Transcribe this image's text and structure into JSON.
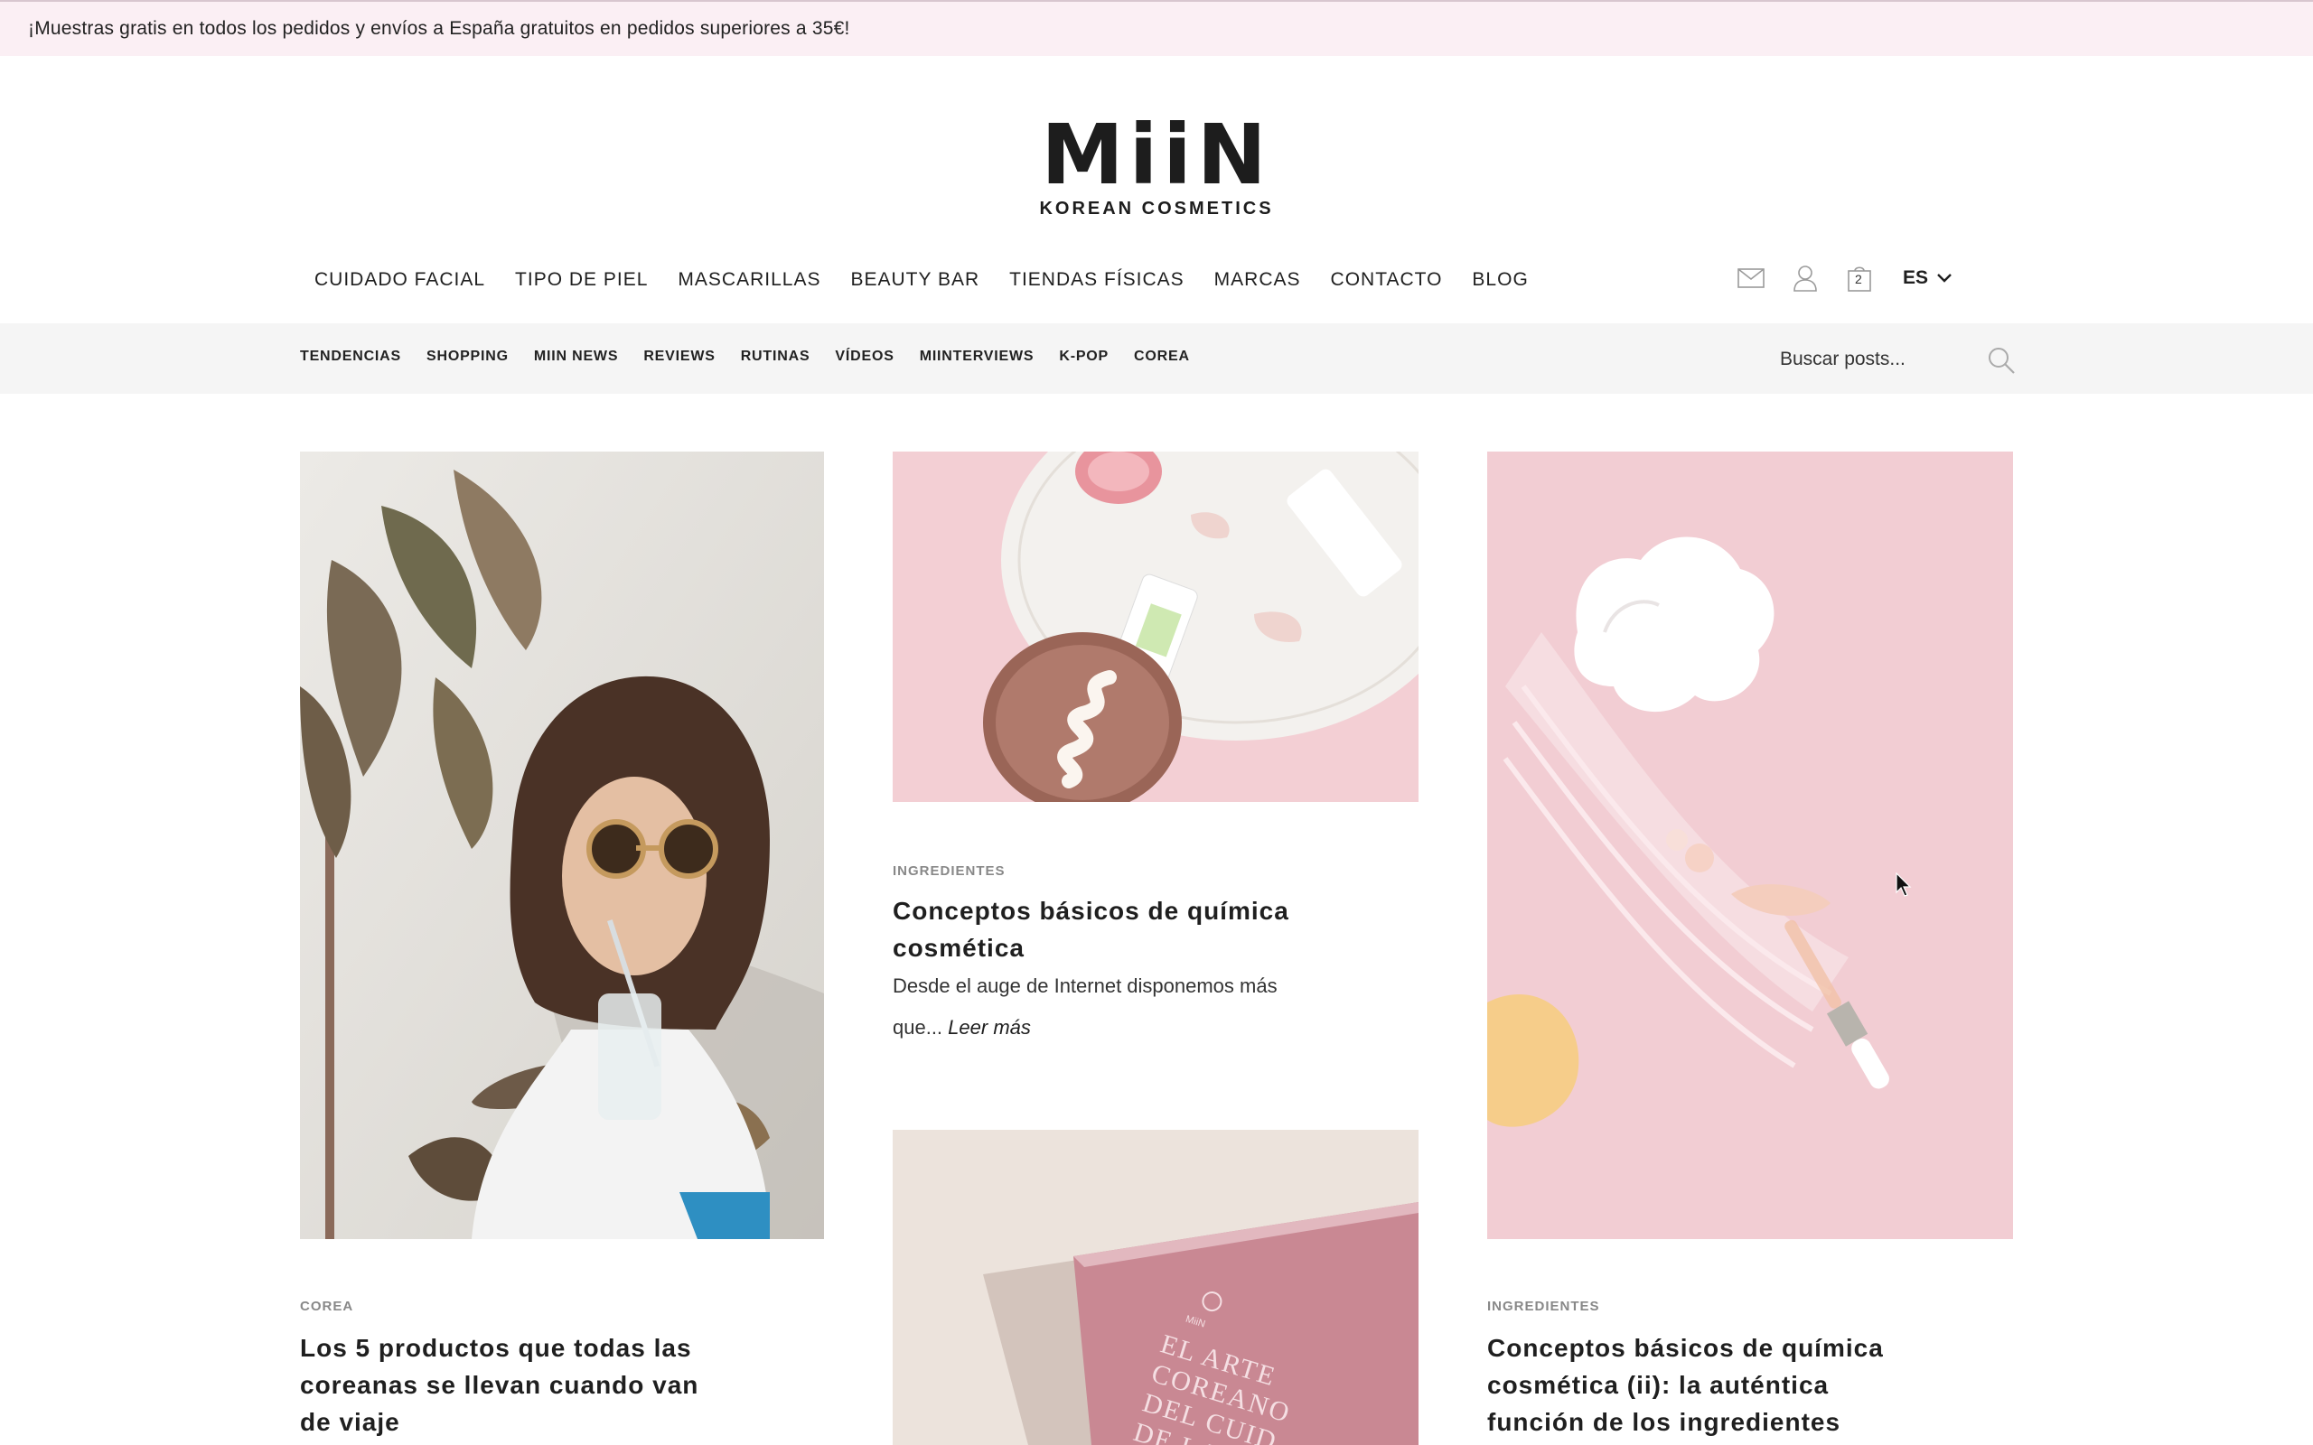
{
  "promo": {
    "text": "¡Muestras gratis en todos los pedidos y envíos a España gratuitos en pedidos superiores a 35€!"
  },
  "logo": {
    "mark": "MiiN",
    "sub": "KOREAN COSMETICS"
  },
  "main_nav": [
    "CUIDADO FACIAL",
    "TIPO DE PIEL",
    "MASCARILLAS",
    "BEAUTY BAR",
    "TIENDAS FÍSICAS",
    "MARCAS",
    "CONTACTO",
    "BLOG"
  ],
  "utilities": {
    "icons": [
      "mail-icon",
      "user-icon",
      "bag-icon"
    ],
    "cart_count": "2",
    "language": "ES"
  },
  "sub_nav": [
    "TENDENCIAS",
    "SHOPPING",
    "MIIN NEWS",
    "REVIEWS",
    "RUTINAS",
    "VÍDEOS",
    "MIINTERVIEWS",
    "K-POP",
    "COREA"
  ],
  "search": {
    "placeholder": "Buscar posts..."
  },
  "posts": [
    {
      "category": "COREA",
      "title": "Los 5 productos que todas las coreanas se llevan cuando van de viaje",
      "title_lines": [
        "Los 5 productos que todas las",
        "coreanas se llevan cuando van",
        "de viaje"
      ]
    },
    {
      "category": "INGREDIENTES",
      "title_lines": [
        "Conceptos básicos de química",
        "cosmética"
      ],
      "excerpt_lines": [
        "Desde el auge de Internet disponemos más",
        "que..."
      ],
      "read_more": "Leer más"
    },
    {
      "category": "INGREDIENTES",
      "title_lines": [
        "Conceptos básicos de química",
        "cosmética (ii): la auténtica",
        "función de los ingredientes"
      ]
    },
    {
      "book_text": [
        "EL ARTE",
        "COREANO",
        "DEL CUID",
        "DE LA"
      ]
    }
  ],
  "colors": {
    "promo_bg": "#fbeff4",
    "subbar_bg": "#f5f5f5",
    "pink_bg": "#f2cfd6",
    "text": "#1f1f1f",
    "category": "#888888"
  }
}
